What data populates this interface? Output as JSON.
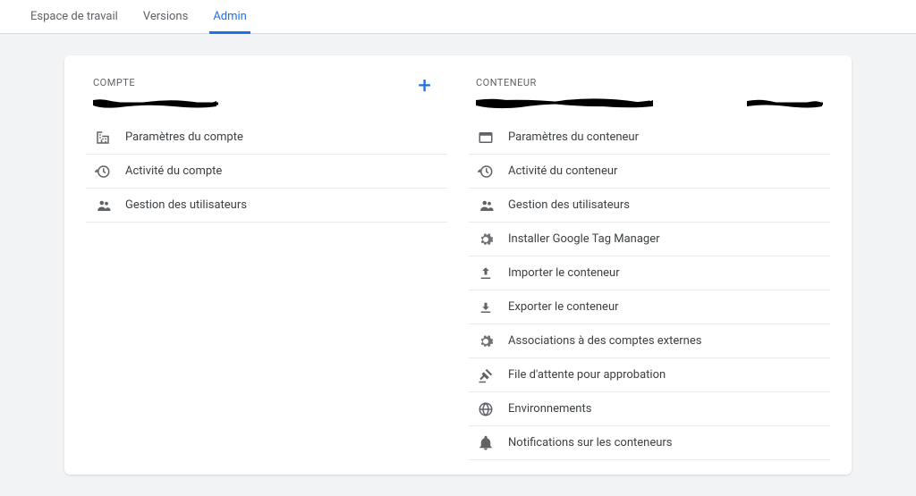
{
  "topnav": {
    "workspace": "Espace de travail",
    "versions": "Versions",
    "admin": "Admin"
  },
  "account": {
    "overline": "COMPTE",
    "title_redacted": true,
    "items": [
      {
        "icon": "domain",
        "label": "Paramètres du compte"
      },
      {
        "icon": "history",
        "label": "Activité du compte"
      },
      {
        "icon": "people",
        "label": "Gestion des utilisateurs"
      }
    ]
  },
  "container": {
    "overline": "CONTENEUR",
    "title_redacted": true,
    "id_redacted": true,
    "items": [
      {
        "icon": "settings-panel",
        "label": "Paramètres du conteneur"
      },
      {
        "icon": "history",
        "label": "Activité du conteneur"
      },
      {
        "icon": "people",
        "label": "Gestion des utilisateurs"
      },
      {
        "icon": "gear",
        "label": "Installer Google Tag Manager"
      },
      {
        "icon": "upload",
        "label": "Importer le conteneur"
      },
      {
        "icon": "download",
        "label": "Exporter le conteneur"
      },
      {
        "icon": "gear",
        "label": "Associations à des comptes externes"
      },
      {
        "icon": "gavel",
        "label": "File d'attente pour approbation"
      },
      {
        "icon": "globe",
        "label": "Environnements"
      },
      {
        "icon": "bell",
        "label": "Notifications sur les conteneurs"
      }
    ]
  }
}
